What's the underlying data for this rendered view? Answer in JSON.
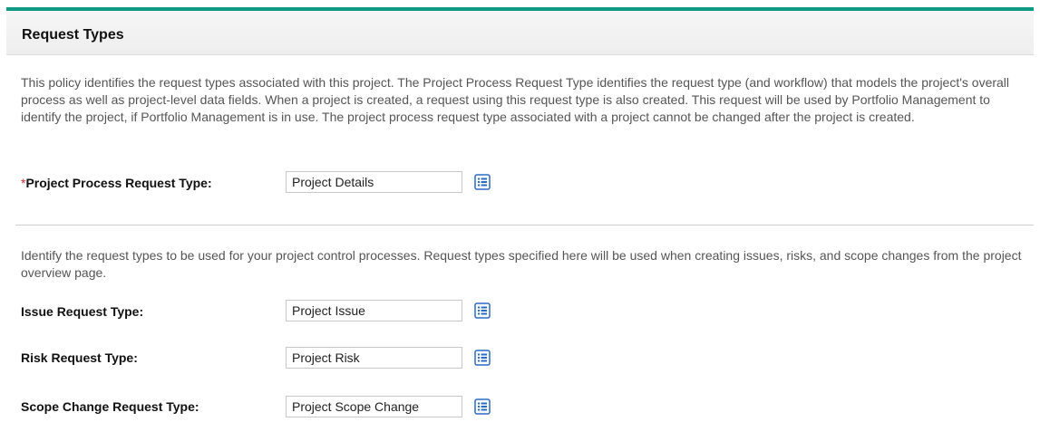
{
  "section": {
    "title": "Request Types"
  },
  "description_1": "This policy identifies the request types associated with this project. The Project Process Request Type identifies the request type (and workflow) that models the project's overall process as well as project-level data fields. When a project is created, a request using this request type is also created. This request will be used by Portfolio Management to identify the project, if Portfolio Management is in use. The project process request type associated with a project cannot be changed after the project is created.",
  "description_2": "Identify the request types to be used for your project control processes. Request types specified here will be used when creating issues, risks, and scope changes from the project overview page.",
  "fields": {
    "process": {
      "required_mark": "*",
      "label": "Project Process Request Type:",
      "value": "Project Details"
    },
    "issue": {
      "label": "Issue Request Type:",
      "value": "Project Issue"
    },
    "risk": {
      "label": "Risk Request Type:",
      "value": "Project Risk"
    },
    "scope": {
      "label": "Scope Change Request Type:",
      "value": "Project Scope Change"
    }
  },
  "colors": {
    "accent": "#0e9a82",
    "picker_icon": "#2b6cc4",
    "required": "#d0312d"
  },
  "icons": {
    "picker": "list-picker-icon"
  }
}
